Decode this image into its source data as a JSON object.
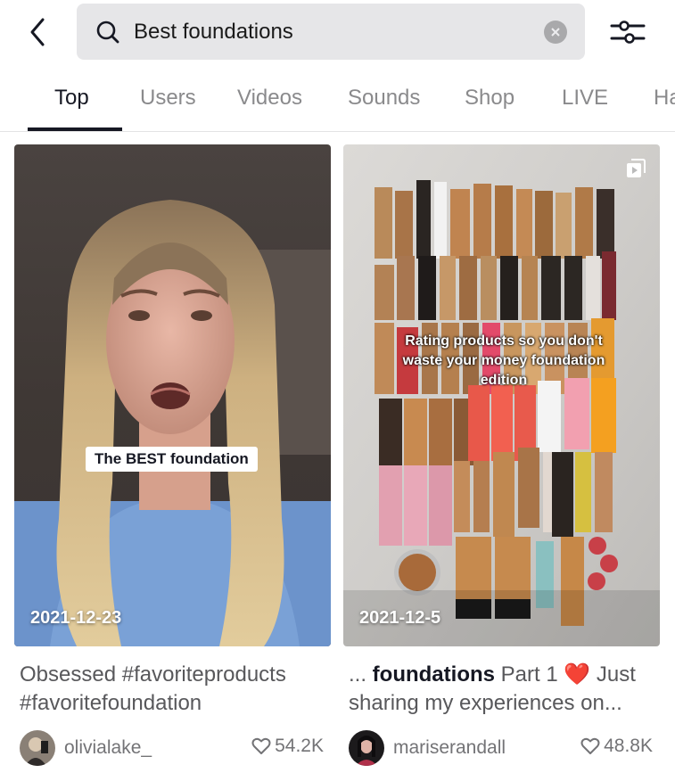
{
  "search": {
    "query": "Best foundations",
    "icon": "search-icon",
    "clear_icon": "clear-icon"
  },
  "toolbar": {
    "back_icon": "chevron-left-icon",
    "filter_icon": "sliders-icon"
  },
  "tabs": [
    {
      "label": "Top",
      "active": true
    },
    {
      "label": "Users",
      "active": false
    },
    {
      "label": "Videos",
      "active": false
    },
    {
      "label": "Sounds",
      "active": false
    },
    {
      "label": "Shop",
      "active": false
    },
    {
      "label": "LIVE",
      "active": false
    },
    {
      "label": "Ha",
      "active": false
    }
  ],
  "results": [
    {
      "date": "2021-12-23",
      "overlay_text": "The BEST foundation",
      "caption_plain": "Obsessed #favoriteproducts #favoritefoundation",
      "author": "olivialake_",
      "likes": "54.2K"
    },
    {
      "date": "2021-12-5",
      "overlay_text": "Rating products so you don't waste your money foundation edition",
      "caption_prefix": "... ",
      "caption_bold": "foundations",
      "caption_rest": " Part 1 ❤️ Just sharing my experiences on...",
      "author": "mariserandall",
      "likes": "48.8K",
      "multi_video_icon": "multi-video-icon"
    }
  ]
}
